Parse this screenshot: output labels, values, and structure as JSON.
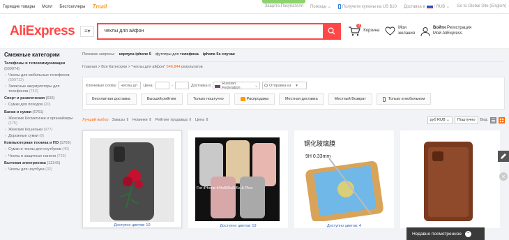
{
  "topbar": {
    "left_links": [
      "Горящие товары",
      "Молл",
      "Бестселлеры"
    ],
    "tmall": "Tmall",
    "protection": "Защита Покупателя",
    "help": "Помощь",
    "coupon": "Получите купоны на US $10",
    "delivery": "Доставка в",
    "currency": "/ RUB",
    "global_site": "Go to Global Site (English)"
  },
  "header": {
    "logo": "AliExpress",
    "search_value": "чехлы для айфон",
    "cart_label": "Корзина",
    "cart_count": "0",
    "wishlist_line1": "Мои",
    "wishlist_line2": "желания",
    "login": "Войти",
    "register": "Регистрация",
    "account": "Мой AliExpress"
  },
  "sidebar": {
    "title": "Смежные категории",
    "items": [
      {
        "label": "Телефоны и телекоммуникации",
        "count": "(530074)",
        "type": "cat"
      },
      {
        "label": "Чехлы для мобильных телефонов",
        "count": "(509712)",
        "type": "sub"
      },
      {
        "label": "Запасные аккумуляторы для телефонов",
        "count": "(742)",
        "type": "sub"
      },
      {
        "label": "Спорт и развлечения",
        "count": "(636)",
        "type": "cat"
      },
      {
        "label": "Сумки для походов",
        "count": "(20)",
        "type": "sub"
      },
      {
        "label": "Багаж и сумки",
        "count": "(5751)",
        "type": "cat"
      },
      {
        "label": "Женские Косметички и органайзеры",
        "count": "(175)",
        "type": "sub"
      },
      {
        "label": "Женские Кошельки",
        "count": "(977)",
        "type": "sub"
      },
      {
        "label": "Дорожные сумки",
        "count": "(8)",
        "type": "sub"
      },
      {
        "label": "Компьютерная техника и ПО",
        "count": "(1703)",
        "type": "cat"
      },
      {
        "label": "Сумки и чехлы для ноутбуков",
        "count": "(40)",
        "type": "sub"
      },
      {
        "label": "Чехлы и защитные панели",
        "count": "(729)",
        "type": "sub"
      },
      {
        "label": "Бытовая электроника",
        "count": "(12141)",
        "type": "cat"
      },
      {
        "label": "Чехлы для ноутбука",
        "count": "(32)",
        "type": "sub"
      }
    ]
  },
  "related": {
    "label": "Похожие запросы:",
    "queries": [
      {
        "pre": "",
        "bold": "корпуса iphone 5"
      },
      {
        "pre": "футляры для ",
        "bold": "телефона"
      },
      {
        "pre": "",
        "bold": "iphone 5s случае"
      }
    ]
  },
  "breadcrumb": {
    "text": "Главная > Все Категории > \"чехлы для айфон\"",
    "count": "548,844",
    "suffix": "результатов"
  },
  "filters": {
    "keywords_label": "Ключевые слова:",
    "keywords_value": "чехлы дл",
    "price_label": "Цена:",
    "ship_to_label": "Доставка в",
    "ship_to_value": "Russian Federation",
    "ship_from_label": "Отправка из",
    "tags": [
      "Бесплатная доставка",
      "Высший рейтинг",
      "Только поштучно",
      "Распродажа",
      "Местная доставка",
      "Местный Возврат",
      "Только в мобильном"
    ]
  },
  "sort": {
    "items": [
      "Лучший выбор",
      "Заказы",
      "Новинки",
      "Рейтинг продавца",
      "Цена"
    ],
    "currency": "руб RUB",
    "per_piece": "Поштучно",
    "view_label": "Вид:"
  },
  "products": [
    {
      "colors": "Доступно цветов: 10"
    },
    {
      "colors": "Доступно цветов: 19",
      "img_text": "For iPhone 4/4s/5/5s/6/6s & Plus"
    },
    {
      "colors": "Доступно цветов: 4",
      "img_text1": "钢化玻璃膜",
      "img_text2": "9H  0.33mm"
    },
    {
      "colors": ""
    }
  ],
  "recent": "Недавно посмотренное"
}
